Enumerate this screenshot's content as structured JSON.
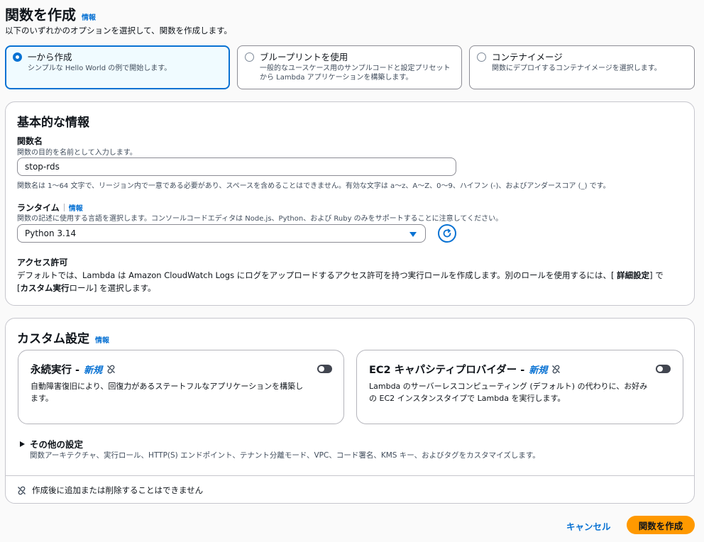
{
  "header": {
    "title": "関数を作成",
    "info": "情報",
    "subtitle": "以下のいずれかのオプションを選択して、関数を作成します。"
  },
  "options": [
    {
      "title": "一から作成",
      "desc": "シンプルな Hello World の例で開始します。",
      "selected": true
    },
    {
      "title": "ブループリントを使用",
      "desc": "一般的なユースケース用のサンプルコードと設定プリセット",
      "desc2": "から Lambda アプリケーションを構築します。",
      "selected": false
    },
    {
      "title": "コンテナイメージ",
      "desc": "関数にデプロイするコンテナイメージを選択します。",
      "selected": false
    }
  ],
  "basic": {
    "title": "基本的な情報",
    "function_name_label": "関数名",
    "function_name_desc": "関数の目的を名前として入力します。",
    "function_name_value": "stop-rds",
    "function_name_constraint": "関数名は 1～64 文字で、リージョン内で一意である必要があり、スペースを含めることはできません。有効な文字は a～z、A～Z、0～9、ハイフン (-)、およびアンダースコア (_) です。",
    "runtime_label": "ランタイム",
    "runtime_info": "情報",
    "runtime_desc": "関数の記述に使用する言語を選択します。コンソールコードエディタは Node.js、Python、および Ruby のみをサポートすることに注意してください。",
    "runtime_value": "Python 3.14",
    "access_label": "アクセス許可",
    "access_line1_a": "デフォルトでは、Lambda は Amazon CloudWatch Logs にログをアップロードするアクセス許可を持つ実行ロールを作成します。別のロールを使用するには、[ ",
    "access_line1_b": "詳細設定",
    "access_line1_c": "] で",
    "access_line2_a": "[",
    "access_line2_b": "カスタム実行",
    "access_line2_c": "ロール] を選択します。"
  },
  "custom": {
    "title": "カスタム設定",
    "info": "情報",
    "durable": {
      "title": "永続実行 -",
      "new": "新規",
      "desc1": "自動障害復旧により、回復力があるステートフルなアプリケーションを構築し",
      "desc2": "ます。",
      "enabled": false
    },
    "ec2": {
      "title": "EC2 キャパシティプロバイダー -",
      "new": "新規",
      "desc1": "Lambda のサーバーレスコンピューティング (デフォルト) の代わりに、お好み",
      "desc2": "の EC2 インスタンスタイプで Lambda を実行します。",
      "enabled": false
    },
    "other_title": "その他の設定",
    "other_desc": "関数アーキテクチャ、実行ロール、HTTP(S) エンドポイント、テナント分離モード、VPC、コード署名、KMS キー、およびタグをカスタマイズします。",
    "footer_note": "作成後に追加または削除することはできません"
  },
  "actions": {
    "cancel": "キャンセル",
    "create": "関数を作成"
  },
  "colors": {
    "accent": "#0972d3",
    "primary_button": "#ff9900"
  }
}
